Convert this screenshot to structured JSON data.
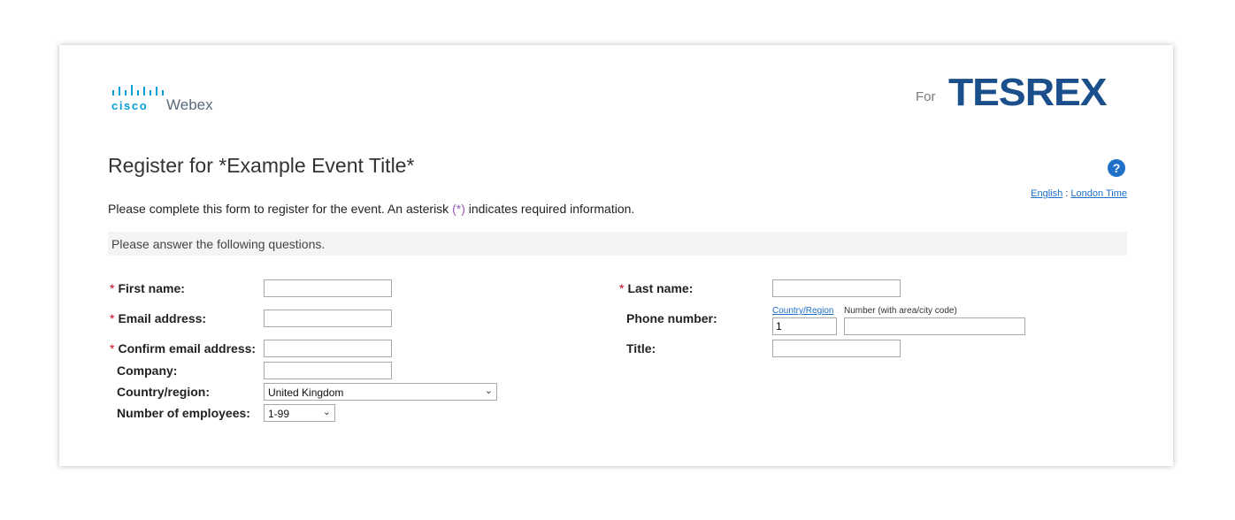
{
  "brand": {
    "cisco_text": "cisco",
    "webex_text": "Webex",
    "for_label": "For",
    "partner_logo_text": "TESREX",
    "logo_color": "#049fd9",
    "partner_color": "#1a4f8b"
  },
  "page": {
    "title": "Register for *Example Event Title*",
    "help_icon": "help-question-icon",
    "help_glyph": "?",
    "language_link": "English",
    "separator": ":",
    "timezone_link": "London Time",
    "intro_before": "Please complete this form to register for the event. An asterisk ",
    "intro_marker": "(*)",
    "intro_after": " indicates required information."
  },
  "section": {
    "heading": "Please answer the following questions."
  },
  "form": {
    "required_marker": "*",
    "first_name": {
      "label": "First name:",
      "value": ""
    },
    "email": {
      "label": "Email address:",
      "value": ""
    },
    "confirm_email": {
      "label": "Confirm email address:",
      "value": ""
    },
    "company": {
      "label": "Company:",
      "value": ""
    },
    "country": {
      "label": "Country/region:",
      "selected": "United Kingdom"
    },
    "employees": {
      "label": "Number of employees:",
      "selected": "1-99"
    },
    "last_name": {
      "label": "Last name:",
      "value": ""
    },
    "phone": {
      "label": "Phone number:",
      "country_link": "Country/Region",
      "number_hint": "Number (with area/city code)",
      "country_code": "1",
      "number": ""
    },
    "title": {
      "label": "Title:",
      "value": ""
    }
  }
}
